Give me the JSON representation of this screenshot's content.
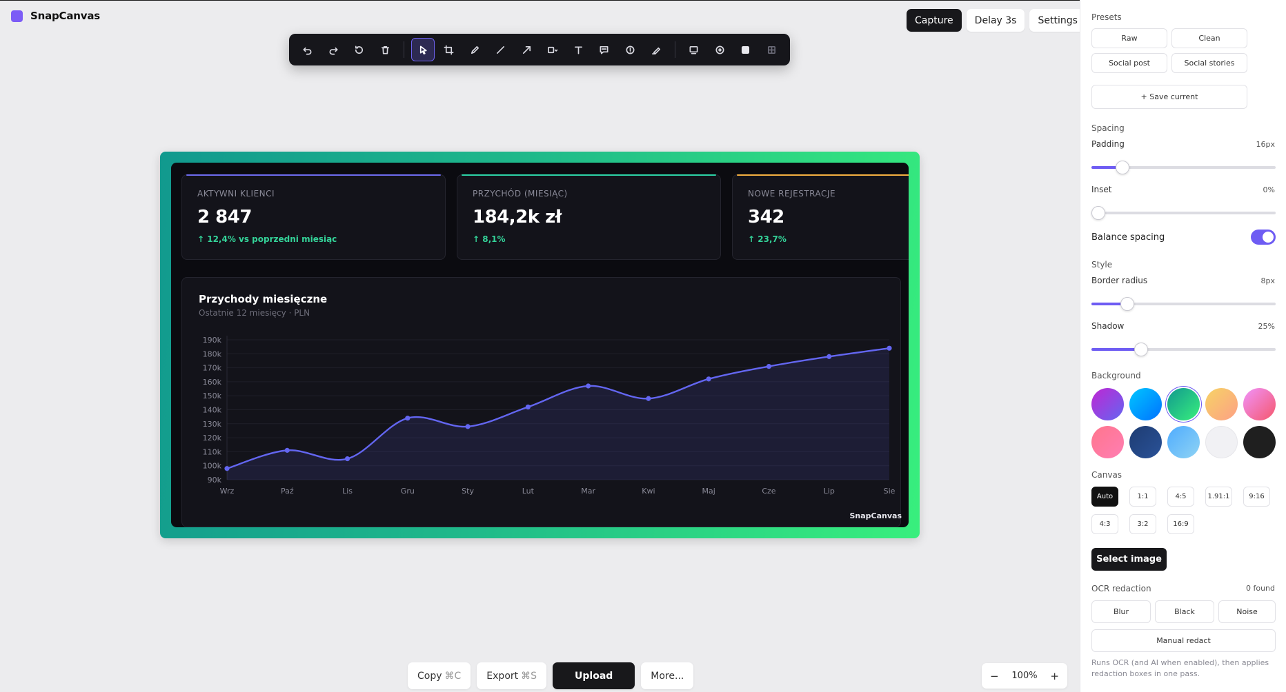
{
  "app": {
    "name": "SnapCanvas"
  },
  "toolbar": {
    "tools": [
      "undo-icon",
      "redo-icon",
      "reset-icon",
      "trash-icon",
      "pointer-icon",
      "crop-icon",
      "pen-icon",
      "line-icon",
      "arrow-icon",
      "shape-icon",
      "text-icon",
      "comment-icon",
      "counter-icon",
      "highlighter-icon",
      "blur-icon",
      "spotlight-icon",
      "rect-fill-icon",
      "pixelate-icon"
    ],
    "active": "pointer-icon"
  },
  "top_actions": {
    "capture": "Capture",
    "delay": "Delay 3s",
    "settings": "Settings"
  },
  "kpis": [
    {
      "label": "AKTYWNI KLIENCI",
      "value": "2 847",
      "delta": "↑ 12,4% vs poprzedni miesiąc",
      "accent": "#6e6cf0"
    },
    {
      "label": "PRZYCHÓD (MIESIĄC)",
      "value": "184,2k zł",
      "delta": "↑ 8,1%",
      "accent": "#2dd4a7"
    },
    {
      "label": "NOWE REJESTRACJE",
      "value": "342",
      "delta": "↑ 23,7%",
      "accent": "#f5b041"
    }
  ],
  "chart": {
    "title": "Przychody miesięczne",
    "subtitle": "Ostatnie 12 miesięcy · PLN",
    "watermark": "SnapCanvas"
  },
  "chart_data": {
    "type": "area",
    "categories": [
      "Wrz",
      "Paź",
      "Lis",
      "Gru",
      "Sty",
      "Lut",
      "Mar",
      "Kwi",
      "Maj",
      "Cze",
      "Lip",
      "Sie"
    ],
    "values": [
      98000,
      111000,
      105000,
      134000,
      128000,
      142000,
      157000,
      148000,
      162000,
      171000,
      178000,
      184000
    ],
    "ylim": [
      90000,
      190000
    ],
    "yticks": [
      "90k",
      "100k",
      "110k",
      "120k",
      "130k",
      "140k",
      "150k",
      "160k",
      "170k",
      "180k",
      "190k"
    ],
    "color": "#6366f1",
    "grid": true
  },
  "bottom": {
    "copy": "Copy",
    "copy_kbd": "⌘C",
    "export": "Export",
    "export_kbd": "⌘S",
    "upload": "Upload",
    "more": "More..."
  },
  "zoom": {
    "minus": "−",
    "value": "100%",
    "plus": "+"
  },
  "panel": {
    "presets_label": "Presets",
    "presets": [
      "Raw",
      "Clean",
      "Social post",
      "Social stories"
    ],
    "save_current": "+ Save current",
    "spacing_label": "Spacing",
    "padding_label": "Padding",
    "padding_value": "16px",
    "padding_level": 0.14,
    "inset_label": "Inset",
    "inset_value": "0%",
    "inset_level": 0.0,
    "balance_label": "Balance spacing",
    "balance_on": true,
    "style_label": "Style",
    "radius_label": "Border radius",
    "radius_value": "8px",
    "radius_level": 0.17,
    "shadow_label": "Shadow",
    "shadow_value": "25%",
    "shadow_level": 0.25,
    "background_label": "Background",
    "swatches": [
      "#8b5cf6",
      "#1aa3ff",
      "#1fa37a",
      "#fbbf6a",
      "#f472b6",
      "#fb7196",
      "#2a3f7a",
      "#7dd3fc",
      "#f1f1f4",
      "#1f1f1f"
    ],
    "swatch_selected": 2,
    "canvas_label": "Canvas",
    "canvas_options": [
      "Auto",
      "1:1",
      "4:5",
      "1.91:1",
      "9:16",
      "4:3",
      "3:2",
      "16:9"
    ],
    "canvas_selected": "Auto",
    "select_image": "Select image",
    "ocr_label": "OCR redaction",
    "ocr_found": "0 found",
    "ocr_modes": [
      "Blur",
      "Black",
      "Noise"
    ],
    "manual_redact": "Manual redact",
    "note": "Runs OCR (and AI when enabled), then applies redaction boxes in one pass."
  }
}
